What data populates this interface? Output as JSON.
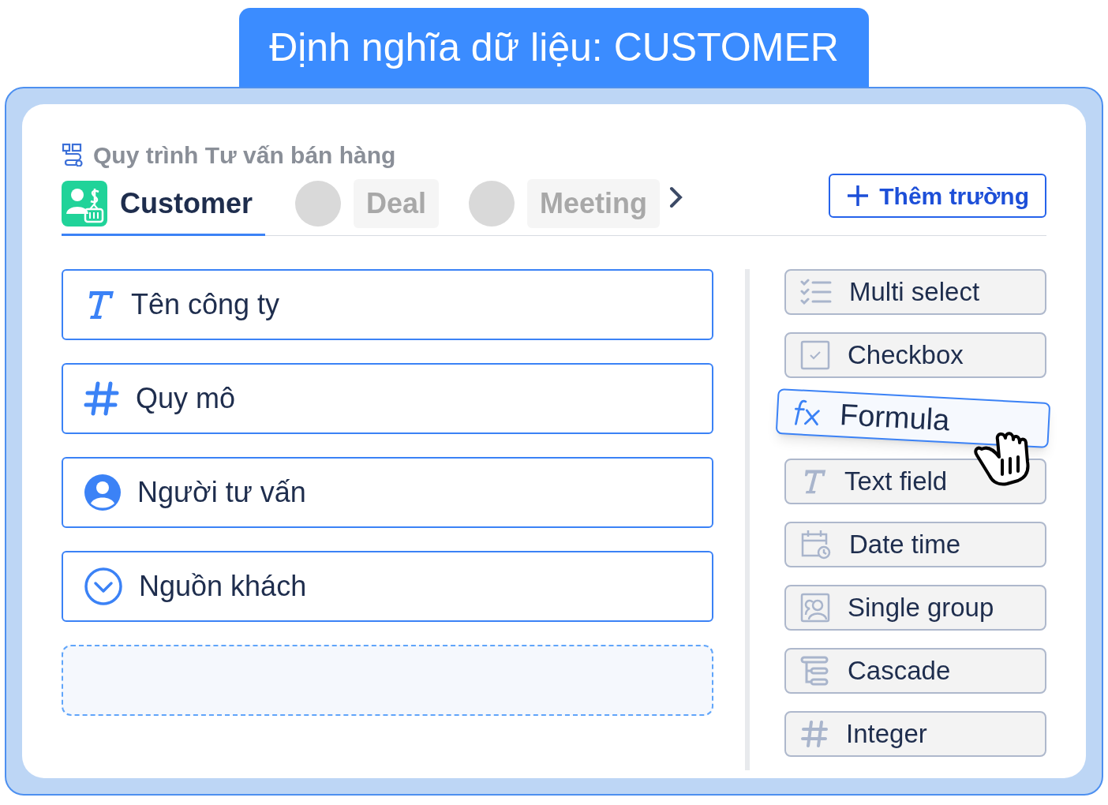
{
  "banner": {
    "title": "Định nghĩa dữ liệu: CUSTOMER"
  },
  "breadcrumb": "Quy trình Tư vấn bán hàng",
  "tabs": [
    {
      "label": "Customer",
      "selected": true
    },
    {
      "label": "Deal",
      "selected": false
    },
    {
      "label": "Meeting",
      "selected": false
    }
  ],
  "add_button": "Thêm trường",
  "fields": [
    {
      "kind": "text",
      "label": "Tên công ty"
    },
    {
      "kind": "number",
      "label": "Quy mô"
    },
    {
      "kind": "person",
      "label": "Người tư vấn"
    },
    {
      "kind": "dropdown",
      "label": "Nguồn khách"
    }
  ],
  "palette": [
    {
      "kind": "multi",
      "label": "Multi select",
      "dragging": false
    },
    {
      "kind": "checkbox",
      "label": "Checkbox",
      "dragging": false
    },
    {
      "kind": "formula",
      "label": "Formula",
      "dragging": true
    },
    {
      "kind": "text",
      "label": "Text field",
      "dragging": false
    },
    {
      "kind": "datetime",
      "label": "Date time",
      "dragging": false
    },
    {
      "kind": "group",
      "label": "Single group",
      "dragging": false
    },
    {
      "kind": "cascade",
      "label": "Cascade",
      "dragging": false
    },
    {
      "kind": "integer",
      "label": "Integer",
      "dragging": false
    }
  ]
}
